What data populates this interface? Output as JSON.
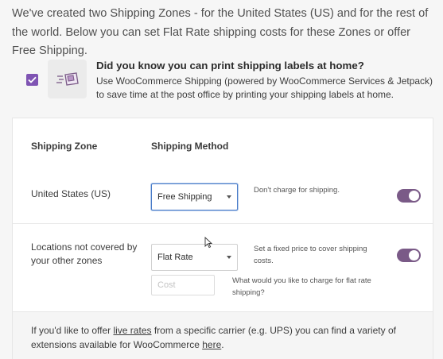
{
  "intro": {
    "text": "We've created two Shipping Zones - for the United States (US) and for the rest of the world. Below you can set Flat Rate shipping costs for these Zones or offer Free Shipping."
  },
  "promo": {
    "checkbox_checked": true,
    "icon": "shipping-label-icon",
    "title": "Did you know you can print shipping labels at home?",
    "description": "Use WooCommerce Shipping (powered by WooCommerce Services & Jetpack) to save time at the post office by printing your shipping labels at home."
  },
  "table": {
    "header_zone": "Shipping Zone",
    "header_method": "Shipping Method",
    "rows": [
      {
        "zone": "United States (US)",
        "method": "Free Shipping",
        "description": "Don't charge for shipping.",
        "enabled": true
      },
      {
        "zone": "Locations not covered by your other zones",
        "method": "Flat Rate",
        "description": "Set a fixed price to cover shipping costs.",
        "enabled": true,
        "cost_placeholder": "Cost",
        "cost_value": "",
        "cost_help": "What would you like to charge for flat rate shipping?"
      }
    ]
  },
  "footer": {
    "text_before": "If you'd like to offer ",
    "live_rates_link": "live rates",
    "text_middle": " from a specific carrier (e.g. UPS) you can find a variety of extensions available for WooCommerce ",
    "here_link": "here",
    "text_after": "."
  },
  "colors": {
    "accent": "#7f54b3",
    "toggle_on": "#7a5a87",
    "focus_border": "#4a7cc9"
  }
}
